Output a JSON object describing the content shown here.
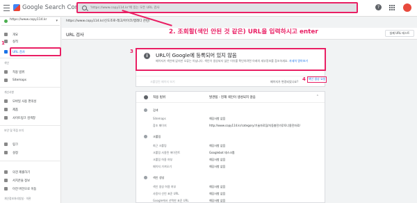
{
  "header": {
    "app_title": "Google Search Console",
    "search_placeholder": "'https://www.copy114.kr'에 있는 모든 URL 검사",
    "help_icon": "?"
  },
  "sidebar": {
    "property": "https://www.copy114.kr",
    "items": [
      {
        "label": "개요",
        "icon": "home-icon"
      },
      {
        "label": "실적",
        "icon": "chart-icon"
      },
      {
        "label": "URL 검사",
        "icon": "search-icon",
        "active": true
      },
      {
        "label": "색인",
        "section": true
      },
      {
        "label": "적용 범위",
        "icon": "coverage-icon"
      },
      {
        "label": "Sitemaps",
        "icon": "sitemap-icon"
      },
      {
        "label": "개선사항",
        "section": true
      },
      {
        "label": "모바일 사용 편의성",
        "icon": "mobile-icon"
      },
      {
        "label": "제품",
        "icon": "product-icon"
      },
      {
        "label": "사이트링크 검색창",
        "icon": "sitelinks-icon"
      },
      {
        "label": "보안 및 직접 조치",
        "section": true
      },
      {
        "label": "링크",
        "icon": "link-icon"
      },
      {
        "label": "설정",
        "icon": "settings-icon"
      },
      {
        "label": "의견 제출하기",
        "icon": "feedback-icon"
      },
      {
        "label": "서치콘솔 정보",
        "icon": "info-icon"
      },
      {
        "label": "이전 버전으로 이동",
        "icon": "back-icon"
      },
      {
        "label": "개인정보처리방침 · 약관",
        "section": true
      }
    ]
  },
  "breadcrumb": "https://www.copy114.kr/신도조로-레고/아이코/앱레디 관련/",
  "page": {
    "title": "URL 검사",
    "live_test_label": "실제 URL 테스트"
  },
  "annotations": {
    "step1": "1",
    "step2": "2. 조회할(색인 안된 것 같은) URL을 입력하시고 enter",
    "step3": "3",
    "step4": "4"
  },
  "status_card": {
    "title": "URL이 Google에 등록되어 있지 않음",
    "description": "페이지가 색인에 없지만 오류는 아닙니다. 색인이 생성되지 않은 이유를 확인하려면 아래의 세부정보를 참조하세요.",
    "link_text": "자세히 알아보기",
    "crawl_button": "크롤링된 페이지 보기",
    "changed_text": "페이지가 변경되었나요?",
    "request_index_button": "색인 생성 요청"
  },
  "coverage": {
    "label": "적용 범위",
    "value": "발견됨 - 현재 색인이 생성되지 않음",
    "discovery_heading": "검색",
    "crawl_heading": "크롤링",
    "indexing_heading": "색인 생성",
    "rows": [
      {
        "label": "Sitemaps",
        "value": "해당사항 없음"
      },
      {
        "label": "참조 페이지",
        "value": "http://www.copy114.kr/category/기술자료집/자동충전가루토너용전자료/"
      },
      {
        "label": "최근 크롤링",
        "value": "해당사항 없음"
      },
      {
        "label": "크롤링 사용된 에이전트",
        "value": "Googlebot 데스크톱"
      },
      {
        "label": "크롤링 허용 여부",
        "value": "해당사항 없음"
      },
      {
        "label": "페이지 가져오기",
        "value": "해당사항 없음"
      },
      {
        "label": "색인 생성 허용 여부",
        "value": "해당사항 없음"
      },
      {
        "label": "사용자 선언 표준 URL",
        "value": "해당사항 없음"
      },
      {
        "label": "Google에서 선택한 표준 URL",
        "value": "해당사항 없음"
      }
    ]
  }
}
